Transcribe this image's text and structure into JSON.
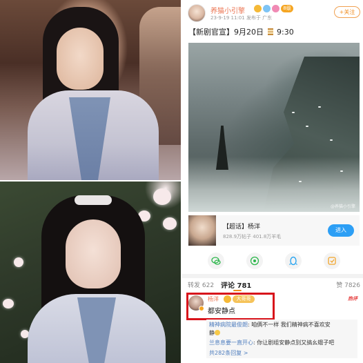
{
  "post": {
    "username": "养猫小引擎",
    "level": "8级",
    "meta": "23-9-19 11:01  发布于 广东",
    "follow_label": "+关注",
    "text_before": "【新剧官宣】9月20日",
    "text_after": "9:30",
    "watermark": "@养猫小引擎"
  },
  "topic": {
    "title": "【超话】杨洋",
    "stats": "828.9万帖子 401.8万羊毛",
    "button": "进入"
  },
  "share_icons": [
    "wechat-icon",
    "moments-icon",
    "qq-icon",
    "save-icon"
  ],
  "tabs": {
    "share": "转发 622",
    "comments": "评论 781",
    "likes": "赞 7826"
  },
  "comment": {
    "username": "杨洋",
    "badge": "大哥哥",
    "text": "都安静点",
    "tag": "热评"
  },
  "replies": [
    {
      "name": "精神病院最俊朗",
      "text": ": 咱俩不一样  我们精神病不喜欢安"
    },
    {
      "name": "",
      "text": "静"
    },
    {
      "name": "兰息息要一直开心",
      "text": ": 你让剧组安静点别又搞幺蛾子吧"
    }
  ],
  "reply_more": "共282条回复 >",
  "colors": {
    "username": "#eb7350",
    "highlight": "#d8131b",
    "enter_button": "#2d9ff5",
    "follow": "#f08b1c"
  }
}
